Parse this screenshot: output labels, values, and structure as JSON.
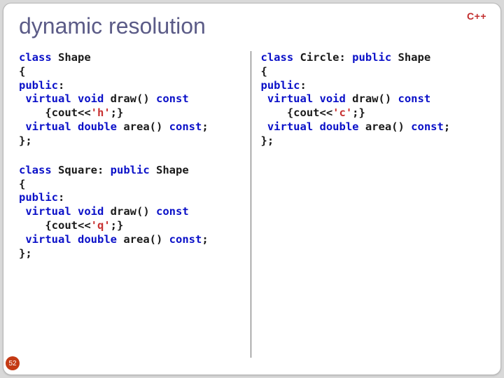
{
  "badge": "C++",
  "title": "dynamic resolution",
  "blocks": {
    "shape": [
      [
        {
          "t": "kw",
          "v": "class"
        },
        {
          "t": "p",
          "v": " Shape"
        }
      ],
      [
        {
          "t": "p",
          "v": "{"
        }
      ],
      [
        {
          "t": "kw",
          "v": "public"
        },
        {
          "t": "p",
          "v": ":"
        }
      ],
      [
        {
          "t": "p",
          "v": " "
        },
        {
          "t": "kw",
          "v": "virtual"
        },
        {
          "t": "p",
          "v": " "
        },
        {
          "t": "kw",
          "v": "void"
        },
        {
          "t": "p",
          "v": " draw() "
        },
        {
          "t": "kw",
          "v": "const"
        }
      ],
      [
        {
          "t": "p",
          "v": "    {cout<<"
        },
        {
          "t": "ch",
          "v": "'h'"
        },
        {
          "t": "p",
          "v": ";}"
        }
      ],
      [
        {
          "t": "p",
          "v": " "
        },
        {
          "t": "kw",
          "v": "virtual"
        },
        {
          "t": "p",
          "v": " "
        },
        {
          "t": "kw",
          "v": "double"
        },
        {
          "t": "p",
          "v": " area() "
        },
        {
          "t": "kw",
          "v": "const"
        },
        {
          "t": "p",
          "v": ";"
        }
      ],
      [
        {
          "t": "p",
          "v": "};"
        }
      ]
    ],
    "square": [
      [
        {
          "t": "kw",
          "v": "class"
        },
        {
          "t": "p",
          "v": " Square: "
        },
        {
          "t": "kw",
          "v": "public"
        },
        {
          "t": "p",
          "v": " Shape"
        }
      ],
      [
        {
          "t": "p",
          "v": "{"
        }
      ],
      [
        {
          "t": "kw",
          "v": "public"
        },
        {
          "t": "p",
          "v": ":"
        }
      ],
      [
        {
          "t": "p",
          "v": " "
        },
        {
          "t": "kw",
          "v": "virtual"
        },
        {
          "t": "p",
          "v": " "
        },
        {
          "t": "kw",
          "v": "void"
        },
        {
          "t": "p",
          "v": " draw() "
        },
        {
          "t": "kw",
          "v": "const"
        }
      ],
      [
        {
          "t": "p",
          "v": "    {cout<<"
        },
        {
          "t": "ch",
          "v": "'q'"
        },
        {
          "t": "p",
          "v": ";}"
        }
      ],
      [
        {
          "t": "p",
          "v": " "
        },
        {
          "t": "kw",
          "v": "virtual"
        },
        {
          "t": "p",
          "v": " "
        },
        {
          "t": "kw",
          "v": "double"
        },
        {
          "t": "p",
          "v": " area() "
        },
        {
          "t": "kw",
          "v": "const"
        },
        {
          "t": "p",
          "v": ";"
        }
      ],
      [
        {
          "t": "p",
          "v": "};"
        }
      ]
    ],
    "circle": [
      [
        {
          "t": "kw",
          "v": "class"
        },
        {
          "t": "p",
          "v": " Circle: "
        },
        {
          "t": "kw",
          "v": "public"
        },
        {
          "t": "p",
          "v": " Shape"
        }
      ],
      [
        {
          "t": "p",
          "v": "{"
        }
      ],
      [
        {
          "t": "kw",
          "v": "public"
        },
        {
          "t": "p",
          "v": ":"
        }
      ],
      [
        {
          "t": "p",
          "v": " "
        },
        {
          "t": "kw",
          "v": "virtual"
        },
        {
          "t": "p",
          "v": " "
        },
        {
          "t": "kw",
          "v": "void"
        },
        {
          "t": "p",
          "v": " draw() "
        },
        {
          "t": "kw",
          "v": "const"
        }
      ],
      [
        {
          "t": "p",
          "v": "    {cout<<"
        },
        {
          "t": "ch",
          "v": "'c'"
        },
        {
          "t": "p",
          "v": ";}"
        }
      ],
      [
        {
          "t": "p",
          "v": " "
        },
        {
          "t": "kw",
          "v": "virtual"
        },
        {
          "t": "p",
          "v": " "
        },
        {
          "t": "kw",
          "v": "double"
        },
        {
          "t": "p",
          "v": " area() "
        },
        {
          "t": "kw",
          "v": "const"
        },
        {
          "t": "p",
          "v": ";"
        }
      ],
      [
        {
          "t": "p",
          "v": "};"
        }
      ]
    ]
  },
  "pageNumber": "52"
}
